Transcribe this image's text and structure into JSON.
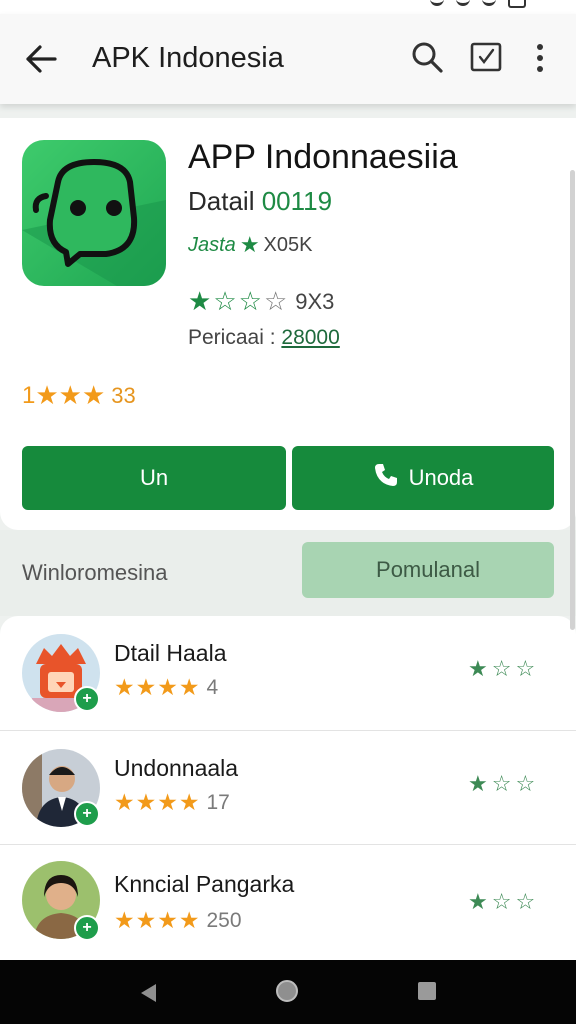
{
  "app_bar": {
    "title": "APK Indonesia"
  },
  "detail": {
    "app_name": "APP Indonnaesiia",
    "detail_prefix": "Datail",
    "detail_value": "00119",
    "tag_text": "Jasta",
    "tag_count": "X05K",
    "rating_count": "9X3",
    "period_label": "Pericaai :",
    "period_value": "28000",
    "orange_rating_prefix": "1",
    "orange_rating_count": "33",
    "button_left": "Un",
    "button_right": "Unoda"
  },
  "filter": {
    "label": "Winloromesina",
    "chip": "Pomulanal"
  },
  "list": [
    {
      "name": "Dtail Haala",
      "count": "4"
    },
    {
      "name": "Undonnaala",
      "count": "17"
    },
    {
      "name": "Knncial Pangarka",
      "count": "250"
    }
  ],
  "colors": {
    "accent_green": "#168a3c",
    "star_orange": "#f29a1a",
    "chip_green": "#a8d4b2"
  },
  "icons": [
    "arrow-back-icon",
    "search-icon",
    "check-box-icon",
    "more-vert-icon",
    "phone-icon",
    "star-icon",
    "add-icon",
    "nav-back-icon",
    "nav-home-icon",
    "nav-recents-icon"
  ]
}
